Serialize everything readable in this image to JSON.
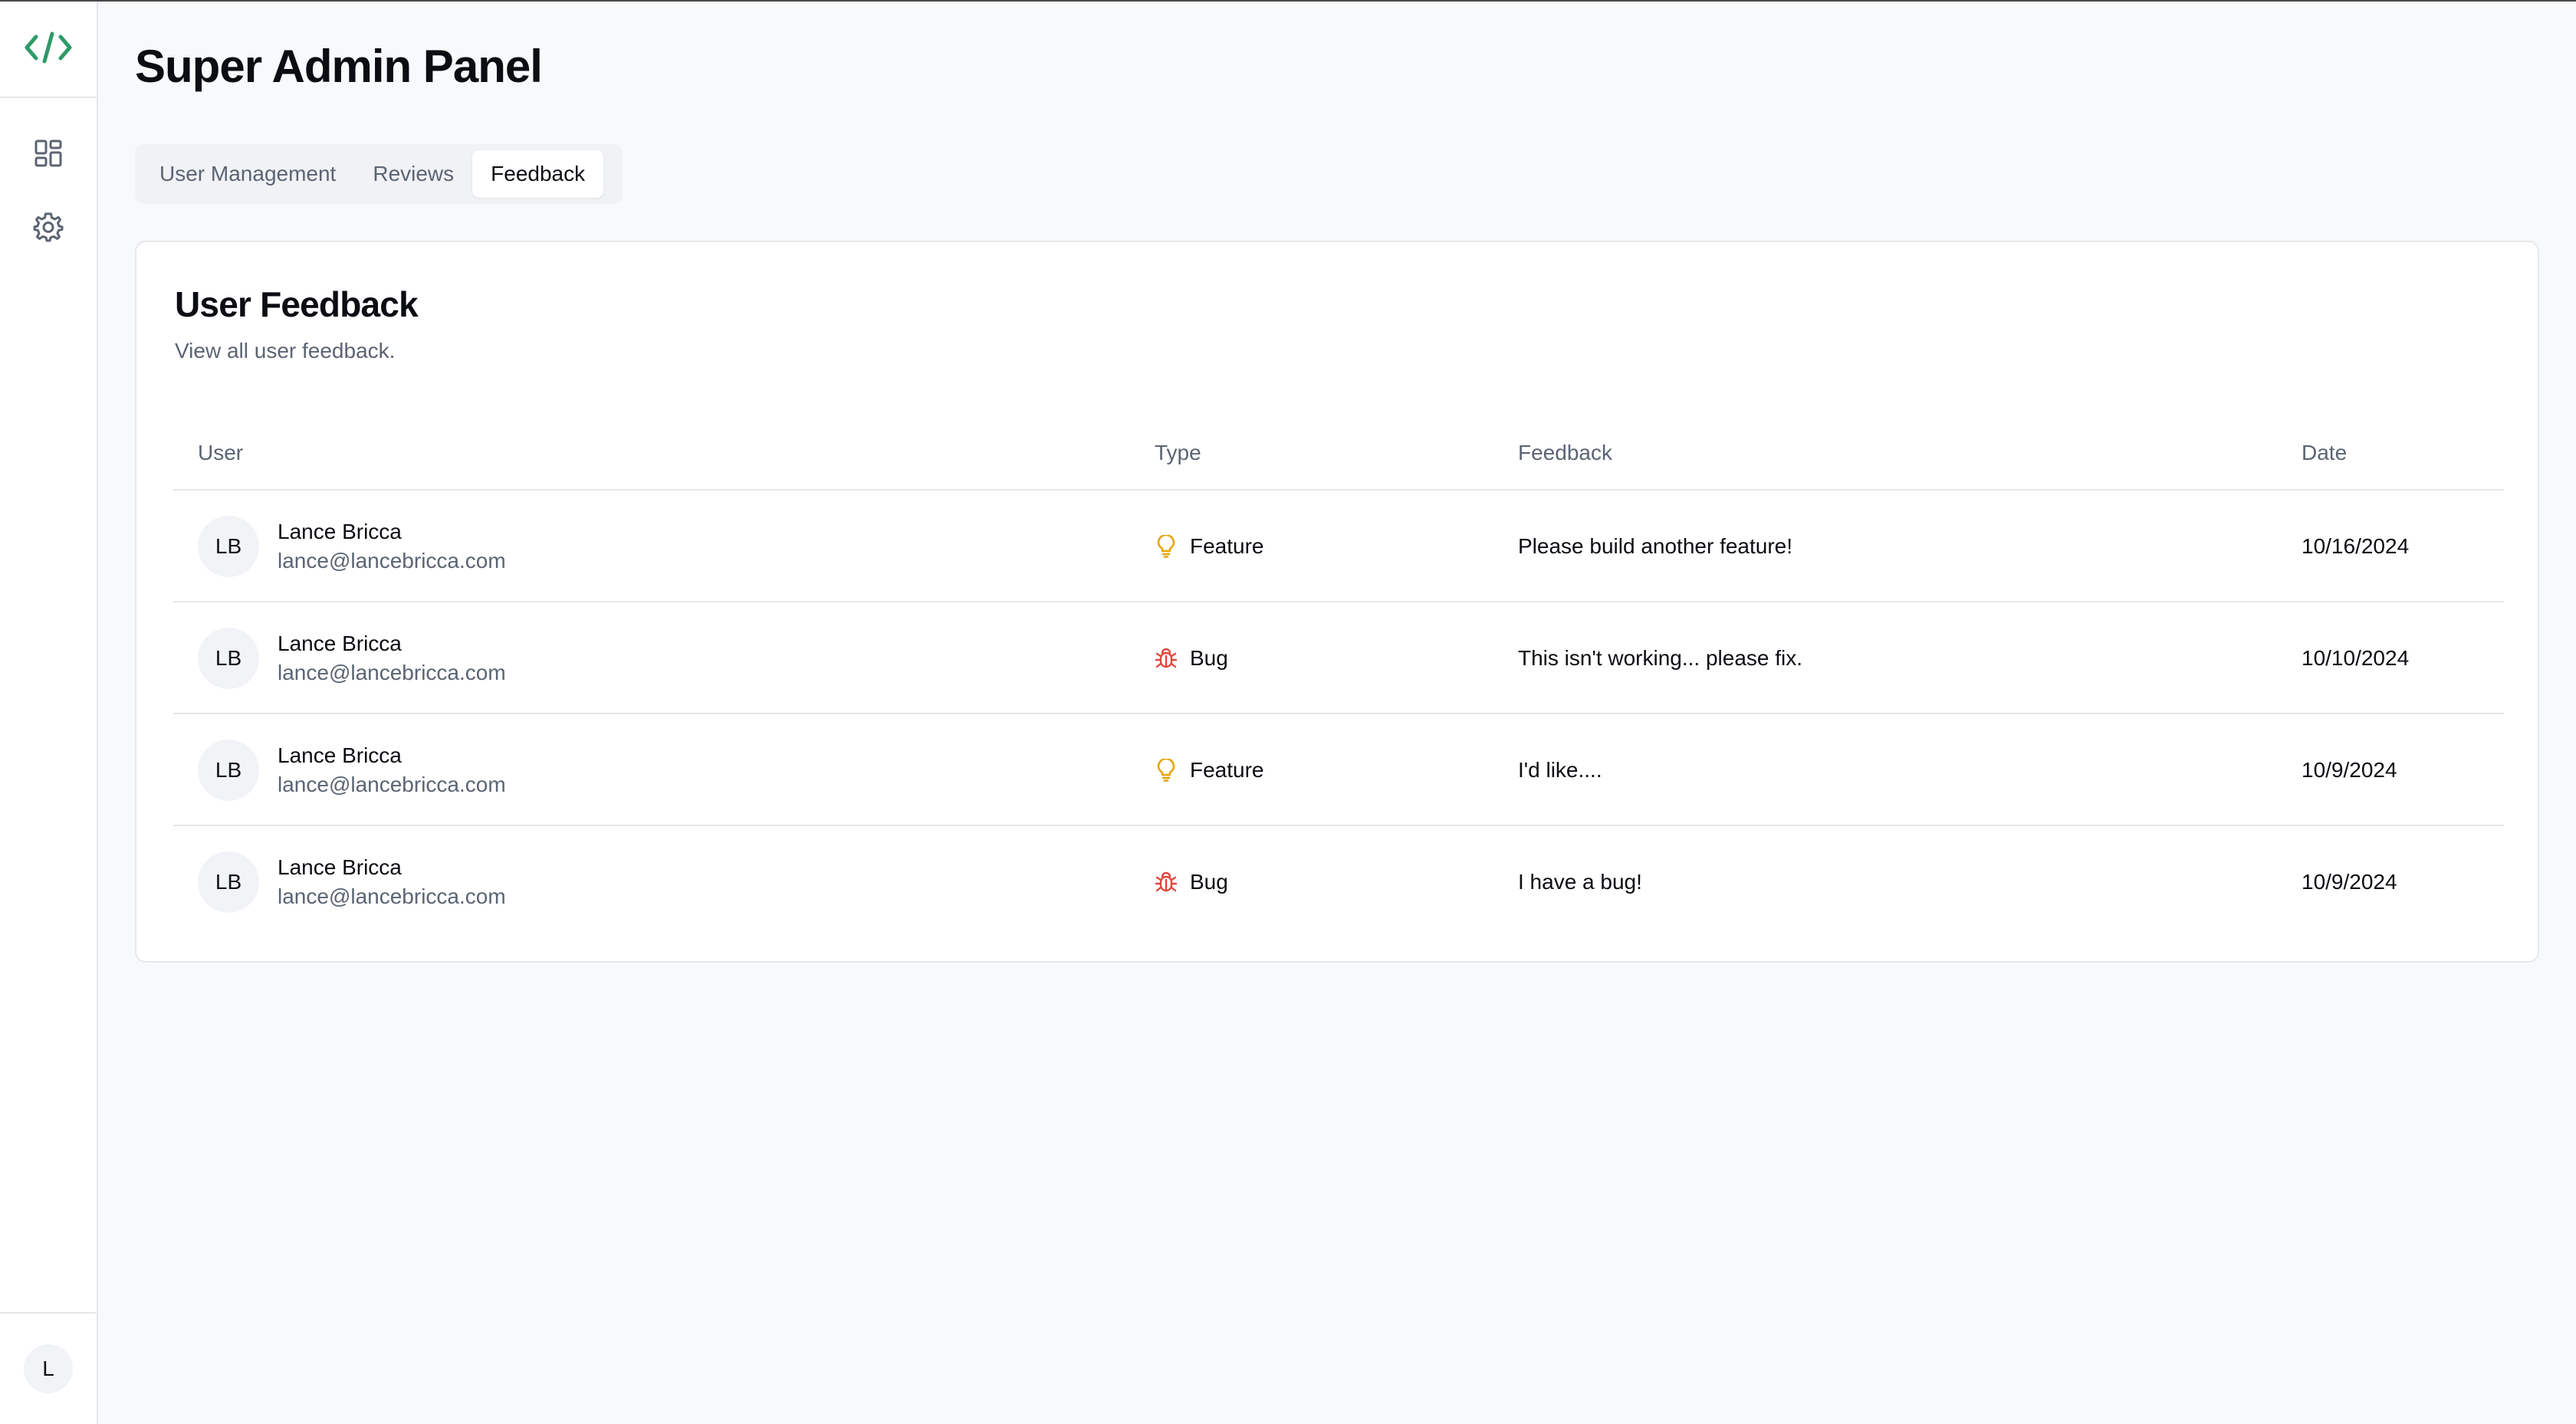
{
  "app": {
    "title": "Super Admin Panel",
    "accent_color": "#2f9a6a",
    "logo_icon": "code-brackets-icon"
  },
  "sidebar": {
    "items": [
      {
        "icon": "dashboard-grid-icon"
      },
      {
        "icon": "gear-icon"
      }
    ],
    "user_initial": "L"
  },
  "tabs": [
    {
      "label": "User Management",
      "active": false
    },
    {
      "label": "Reviews",
      "active": false
    },
    {
      "label": "Feedback",
      "active": true
    }
  ],
  "card": {
    "title": "User Feedback",
    "subtitle": "View all user feedback."
  },
  "table": {
    "headers": {
      "user": "User",
      "type": "Type",
      "feedback": "Feedback",
      "date": "Date"
    },
    "rows": [
      {
        "initials": "LB",
        "name": "Lance Bricca",
        "email": "lance@lancebricca.com",
        "type": "Feature",
        "type_icon": "lightbulb-icon",
        "feedback": "Please build another feature!",
        "date": "10/16/2024"
      },
      {
        "initials": "LB",
        "name": "Lance Bricca",
        "email": "lance@lancebricca.com",
        "type": "Bug",
        "type_icon": "bug-icon",
        "feedback": "This isn't working... please fix.",
        "date": "10/10/2024"
      },
      {
        "initials": "LB",
        "name": "Lance Bricca",
        "email": "lance@lancebricca.com",
        "type": "Feature",
        "type_icon": "lightbulb-icon",
        "feedback": "I'd like....",
        "date": "10/9/2024"
      },
      {
        "initials": "LB",
        "name": "Lance Bricca",
        "email": "lance@lancebricca.com",
        "type": "Bug",
        "type_icon": "bug-icon",
        "feedback": "I have a bug!",
        "date": "10/9/2024"
      }
    ],
    "colors": {
      "feature": "#e5a50a",
      "bug": "#e0473a"
    }
  }
}
